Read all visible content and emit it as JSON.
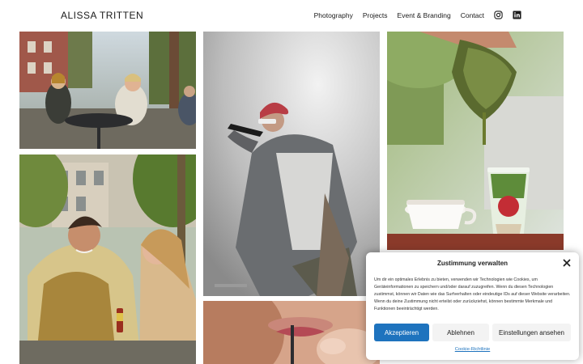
{
  "site": {
    "title": "ALISSA TRITTEN"
  },
  "nav": {
    "items": [
      "Photography",
      "Projects",
      "Event & Branding",
      "Contact"
    ],
    "social_icons": [
      "instagram-icon",
      "linkedin-icon"
    ]
  },
  "gallery": {
    "tiles": [
      {
        "subject": "friends-at-cafe"
      },
      {
        "subject": "singer-on-stage"
      },
      {
        "subject": "matcha-drink-pour"
      },
      {
        "subject": "couple-drinks-park"
      },
      {
        "subject": "woman-straw-closeup"
      }
    ]
  },
  "cookie": {
    "title": "Zustimmung verwalten",
    "body": "Um dir ein optimales Erlebnis zu bieten, verwenden wir Technologien wie Cookies, um Geräteinformationen zu speichern und/oder darauf zuzugreifen. Wenn du diesen Technologien zustimmst, können wir Daten wie das Surfverhalten oder eindeutige IDs auf dieser Website verarbeiten. Wenn du deine Zustimmung nicht erteilst oder zurückziehst, können bestimmte Merkmale und Funktionen beeinträchtigt werden.",
    "accept": "Akzeptieren",
    "deny": "Ablehnen",
    "settings": "Einstellungen ansehen",
    "policy_link": "Cookie-Richtlinie"
  },
  "colors": {
    "accent": "#1e73be",
    "text": "#1a1a1a"
  }
}
